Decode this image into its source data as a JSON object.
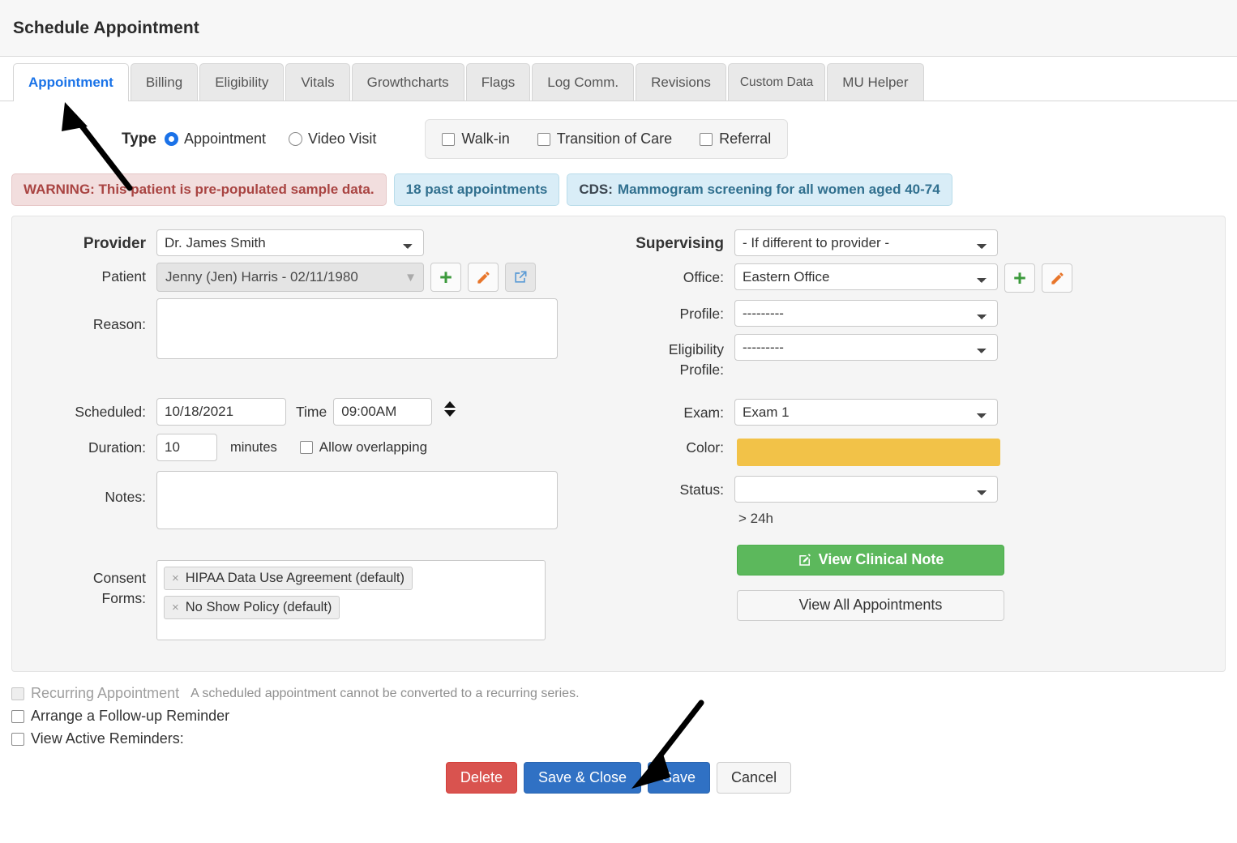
{
  "window": {
    "title": "Schedule Appointment"
  },
  "tabs": [
    {
      "label": "Appointment",
      "active": true
    },
    {
      "label": "Billing",
      "active": false
    },
    {
      "label": "Eligibility",
      "active": false
    },
    {
      "label": "Vitals",
      "active": false
    },
    {
      "label": "Growthcharts",
      "active": false
    },
    {
      "label": "Flags",
      "active": false
    },
    {
      "label": "Log Comm.",
      "active": false
    },
    {
      "label": "Revisions",
      "active": false
    },
    {
      "label": "Custom Data",
      "active": false
    },
    {
      "label": "MU Helper",
      "active": false
    }
  ],
  "type_row": {
    "label": "Type",
    "radios": [
      {
        "label": "Appointment",
        "checked": true
      },
      {
        "label": "Video Visit",
        "checked": false
      }
    ],
    "flags": [
      {
        "label": "Walk-in",
        "checked": false
      },
      {
        "label": "Transition of Care",
        "checked": false
      },
      {
        "label": "Referral",
        "checked": false
      }
    ]
  },
  "banners": {
    "warning": "WARNING: This patient is pre-populated sample data.",
    "past_appointments": "18 past appointments",
    "cds_prefix": "CDS:",
    "cds_text": "Mammogram screening for all women aged 40-74"
  },
  "form_left": {
    "provider_label": "Provider",
    "provider_value": "Dr. James Smith",
    "patient_label": "Patient",
    "patient_value": "Jenny (Jen) Harris - 02/11/1980",
    "reason_label": "Reason:",
    "reason_value": "",
    "scheduled_label": "Scheduled:",
    "scheduled_value": "10/18/2021",
    "time_label": "Time",
    "time_value": "09:00AM",
    "duration_label": "Duration:",
    "duration_value": "10",
    "minutes_label": "minutes",
    "allow_overlapping_label": "Allow overlapping",
    "allow_overlapping_checked": false,
    "notes_label": "Notes:",
    "notes_value": "",
    "consent_label_line1": "Consent",
    "consent_label_line2": "Forms:",
    "consent_tokens": [
      "HIPAA Data Use Agreement (default)",
      "No Show Policy (default)"
    ]
  },
  "form_right": {
    "supervising_label": "Supervising",
    "supervising_value": "- If different to provider -",
    "office_label": "Office:",
    "office_value": "Eastern Office",
    "profile_label": "Profile:",
    "profile_value": "---------",
    "eligibility_label_line1": "Eligibility",
    "eligibility_label_line2": "Profile:",
    "eligibility_value": "---------",
    "exam_label": "Exam:",
    "exam_value": "Exam 1",
    "color_label": "Color:",
    "color_value": "#f2c248",
    "status_label": "Status:",
    "status_value": "",
    "time_note": "> 24h",
    "view_clinical_note_button": "View Clinical Note",
    "view_all_appointments_button": "View All Appointments"
  },
  "bottom": {
    "recurring_label": "Recurring Appointment",
    "recurring_hint": "A scheduled appointment cannot be converted to a recurring series.",
    "recurring_checked": false,
    "followup_label": "Arrange a Follow-up Reminder",
    "followup_checked": false,
    "active_reminders_label": "View Active Reminders:",
    "active_reminders_checked": false
  },
  "actions": {
    "delete": "Delete",
    "save_close": "Save & Close",
    "save": "Save",
    "cancel": "Cancel"
  },
  "colors": {
    "accent_blue": "#1a73e8",
    "primary_button": "#3071c4",
    "danger": "#d9534f",
    "success": "#5cb85c",
    "appointment_color": "#f2c248"
  }
}
